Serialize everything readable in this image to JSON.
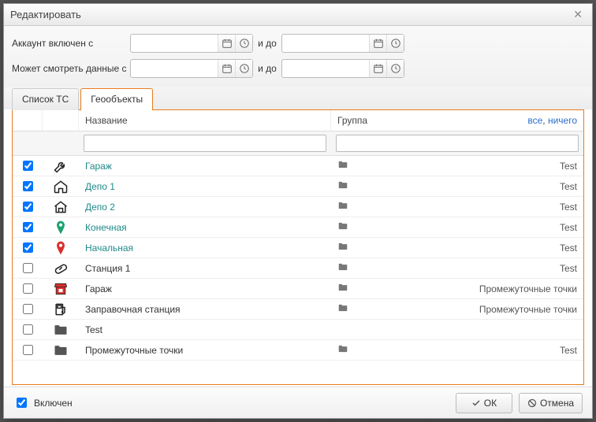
{
  "title": "Редактировать",
  "dates": {
    "account_from_label": "Аккаунт включен с",
    "account_to_label": "и до",
    "data_from_label": "Может смотреть данные с",
    "data_to_label": "и до",
    "account_from": "",
    "account_to": "",
    "data_from": "",
    "data_to": ""
  },
  "tabs": {
    "list_ts": "Список ТС",
    "geoobjects": "Геообъекты"
  },
  "grid": {
    "header_name": "Название",
    "header_group": "Группа",
    "select_all": "все",
    "select_none": "ничего",
    "filter_name": "",
    "filter_group": "",
    "rows": [
      {
        "checked": true,
        "icon": "wrench",
        "name": "Гараж",
        "group": "Test",
        "sel": true
      },
      {
        "checked": true,
        "icon": "home",
        "name": "Депо 1",
        "group": "Test",
        "sel": true
      },
      {
        "checked": true,
        "icon": "home2",
        "name": "Депо 2",
        "group": "Test",
        "sel": true
      },
      {
        "checked": true,
        "icon": "pin-g",
        "name": "Конечная",
        "group": "Test",
        "sel": true
      },
      {
        "checked": true,
        "icon": "pin-r",
        "name": "Начальная",
        "group": "Test",
        "sel": true
      },
      {
        "checked": false,
        "icon": "pill",
        "name": "Станция 1",
        "group": "Test",
        "sel": false
      },
      {
        "checked": false,
        "icon": "store",
        "name": "Гараж",
        "group": "Промежуточные точки",
        "sel": false
      },
      {
        "checked": false,
        "icon": "fuel",
        "name": "Заправочная станция",
        "group": "Промежуточные точки",
        "sel": false
      },
      {
        "checked": false,
        "icon": "folder",
        "name": "Test",
        "group": "",
        "sel": false
      },
      {
        "checked": false,
        "icon": "folder",
        "name": "Промежуточные точки",
        "group": "Test",
        "sel": false
      }
    ]
  },
  "footer": {
    "enabled_label": "Включен",
    "enabled_checked": true,
    "ok": "ОК",
    "cancel": "Отмена"
  }
}
